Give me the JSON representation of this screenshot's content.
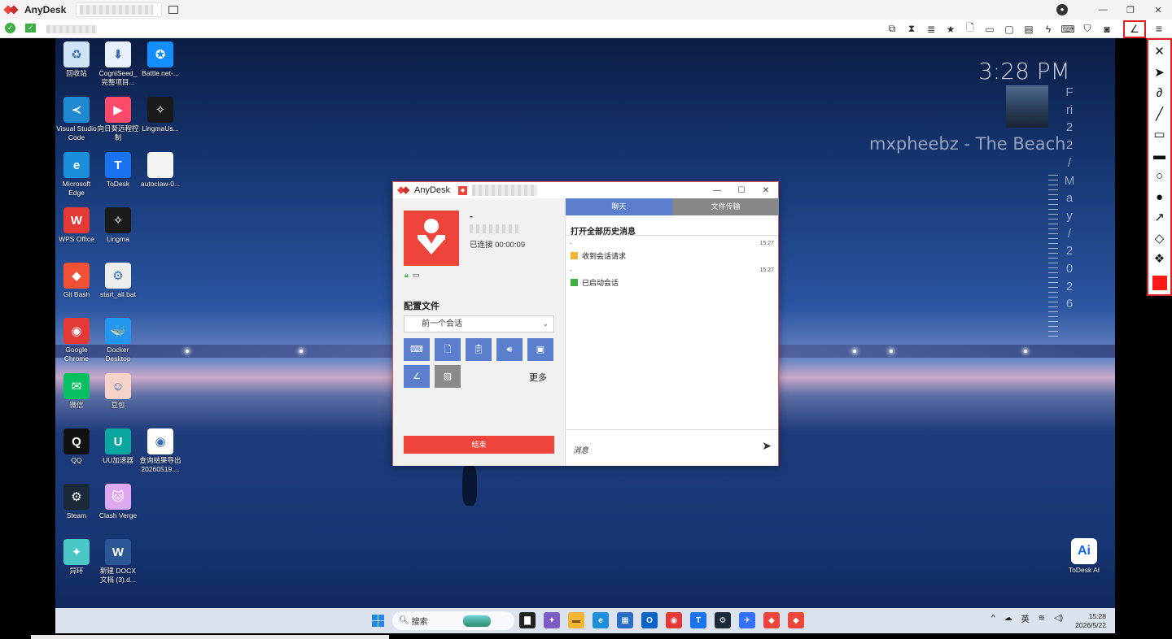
{
  "window": {
    "app_name": "AnyDesk",
    "controls": [
      "—",
      "❐",
      "✕"
    ]
  },
  "toolbar": {
    "icons": [
      "display-settings-icon",
      "hourglass-icon",
      "database-icon",
      "star-icon",
      "file-icon",
      "monitor-icon",
      "display-icon",
      "chat-icon",
      "lightning-icon",
      "keyboard-icon",
      "shield-icon",
      "record-icon"
    ],
    "draw_glyph": "∠",
    "menu_glyph": "≡"
  },
  "desktop": {
    "icons": [
      {
        "label": "回收站",
        "icon": "recycle-bin-icon",
        "glyph": "♻",
        "color": "#cfe3f7"
      },
      {
        "label": "CogniSeed_完整项目...",
        "icon": "download-file-icon",
        "glyph": "⬇",
        "color": "#e8f0fb"
      },
      {
        "label": "Battle.net-...",
        "icon": "battlenet-icon",
        "glyph": "✪",
        "color": "#148eff"
      },
      {
        "label": "Visual Studio Code",
        "icon": "vscode-icon",
        "glyph": "≺",
        "color": "#1f8ad2"
      },
      {
        "label": "向日葵远程控制",
        "icon": "sunlogin-icon",
        "glyph": "▶",
        "color": "#ff4a6b"
      },
      {
        "label": "LingmaUs...",
        "icon": "lingma-icon",
        "glyph": "✧",
        "color": "#1a1a1a"
      },
      {
        "label": "Microsoft Edge",
        "icon": "edge-icon",
        "glyph": "e",
        "color": "#1b8fd9"
      },
      {
        "label": "ToDesk",
        "icon": "todesk-icon",
        "glyph": "T",
        "color": "#1a73f0"
      },
      {
        "label": "autoclaw-0...",
        "icon": "file-icon",
        "glyph": "",
        "color": "#f4f4f4"
      },
      {
        "label": "WPS Office",
        "icon": "wps-icon",
        "glyph": "W",
        "color": "#e53935"
      },
      {
        "label": "Lingma",
        "icon": "lingma-icon",
        "glyph": "✧",
        "color": "#1a1a1a"
      },
      {
        "label": "Git Bash",
        "icon": "git-bash-icon",
        "glyph": "◆",
        "color": "#f05033"
      },
      {
        "label": "start_all.bat",
        "icon": "gear-file-icon",
        "glyph": "⚙",
        "color": "#eeeeee"
      },
      {
        "label": "Google Chrome",
        "icon": "chrome-icon",
        "glyph": "◉",
        "color": "#e53935"
      },
      {
        "label": "Docker Desktop",
        "icon": "docker-icon",
        "glyph": "🐳",
        "color": "#2496ed"
      },
      {
        "label": "微信",
        "icon": "wechat-icon",
        "glyph": "✉",
        "color": "#07c160"
      },
      {
        "label": "豆包",
        "icon": "doubao-icon",
        "glyph": "☺",
        "color": "#f6d2c8"
      },
      {
        "label": "QQ",
        "icon": "qq-icon",
        "glyph": "Q",
        "color": "#111111"
      },
      {
        "label": "UU加速器",
        "icon": "uu-icon",
        "glyph": "U",
        "color": "#0aa6a0"
      },
      {
        "label": "查询结果导出20260519....",
        "icon": "chrome-file-icon",
        "glyph": "◉",
        "color": "#ffffff"
      },
      {
        "label": "Steam",
        "icon": "steam-icon",
        "glyph": "⚙",
        "color": "#1b2838"
      },
      {
        "label": "Clash Verge",
        "icon": "clash-icon",
        "glyph": "🐱",
        "color": "#e0a8f0"
      },
      {
        "label": "异环",
        "icon": "game-icon",
        "glyph": "✦",
        "color": "#4bc7c7"
      },
      {
        "label": "新建 DOCX 文档 (3).d...",
        "icon": "word-doc-icon",
        "glyph": "W",
        "color": "#2b5797"
      }
    ],
    "widget": {
      "time": "3:28 PM",
      "song": "mxpheebz - The Beach",
      "date_chars": [
        "F",
        "ri",
        "2",
        "2",
        "/",
        "M",
        "a",
        "y",
        "/",
        "2",
        "0",
        "2",
        "6"
      ]
    },
    "todesk_ai": {
      "label": "ToDesk AI",
      "glyph": "Ai"
    }
  },
  "taskbar": {
    "search_placeholder": "搜索",
    "apps": [
      {
        "icon": "file-explorer-icon",
        "color": "#222222",
        "glyph": "▇"
      },
      {
        "icon": "copilot-icon",
        "color": "#7c5cc4",
        "glyph": "✦"
      },
      {
        "icon": "folder-icon",
        "color": "#f2b632",
        "glyph": "▬"
      },
      {
        "icon": "edge-icon",
        "color": "#1b8fd9",
        "glyph": "e"
      },
      {
        "icon": "store-icon",
        "color": "#2b6cc4",
        "glyph": "▦"
      },
      {
        "icon": "outlook-icon",
        "color": "#0a64c8",
        "glyph": "O"
      },
      {
        "icon": "chrome-icon",
        "color": "#e53935",
        "glyph": "◉"
      },
      {
        "icon": "todesk-icon",
        "color": "#1a73f0",
        "glyph": "T"
      },
      {
        "icon": "steam-icon",
        "color": "#1b2838",
        "glyph": "⚙"
      },
      {
        "icon": "feishu-icon",
        "color": "#3370ff",
        "glyph": "✈"
      },
      {
        "icon": "anydesk-icon",
        "color": "#ef443b",
        "glyph": "◆"
      },
      {
        "icon": "anydesk-icon",
        "color": "#ef443b",
        "glyph": "◆"
      }
    ],
    "tray": {
      "chevron": "^",
      "ime": "英",
      "wifi": "≋",
      "volume": "◁)"
    },
    "time": "15:28",
    "date": "2026/5/22"
  },
  "anydesk_window": {
    "title": "AnyDesk",
    "controls": [
      "—",
      "☐",
      "✕"
    ],
    "remote_name": "-",
    "status": "已连接 00:00:09",
    "profile_label": "配置文件",
    "profile_value": "前一个会话",
    "more_label": "更多",
    "end_button": "结束",
    "chat_tab": "聊天",
    "file_tab": "文件传输",
    "history_link": "打开全部历史消息",
    "messages": [
      {
        "sender": "-",
        "time": "15:27",
        "text": "收到会话请求"
      },
      {
        "sender": "-",
        "time": "15:27",
        "text": "已启动会话"
      }
    ],
    "input_placeholder": "消息"
  },
  "palette": {
    "tools": [
      {
        "name": "close-palette-icon",
        "glyph": "✕"
      },
      {
        "name": "pointer-icon",
        "glyph": "➤"
      },
      {
        "name": "freehand-icon",
        "glyph": "∂"
      },
      {
        "name": "line-icon",
        "glyph": "╱"
      },
      {
        "name": "rectangle-icon",
        "glyph": "▭"
      },
      {
        "name": "filled-rectangle-icon",
        "glyph": "▬"
      },
      {
        "name": "circle-icon",
        "glyph": "○"
      },
      {
        "name": "filled-circle-icon",
        "glyph": "●"
      },
      {
        "name": "arrow-icon",
        "glyph": "↗"
      },
      {
        "name": "eraser-icon",
        "glyph": "◇"
      },
      {
        "name": "clear-all-icon",
        "glyph": "❖"
      }
    ],
    "current_color": "#ff1a1a"
  }
}
